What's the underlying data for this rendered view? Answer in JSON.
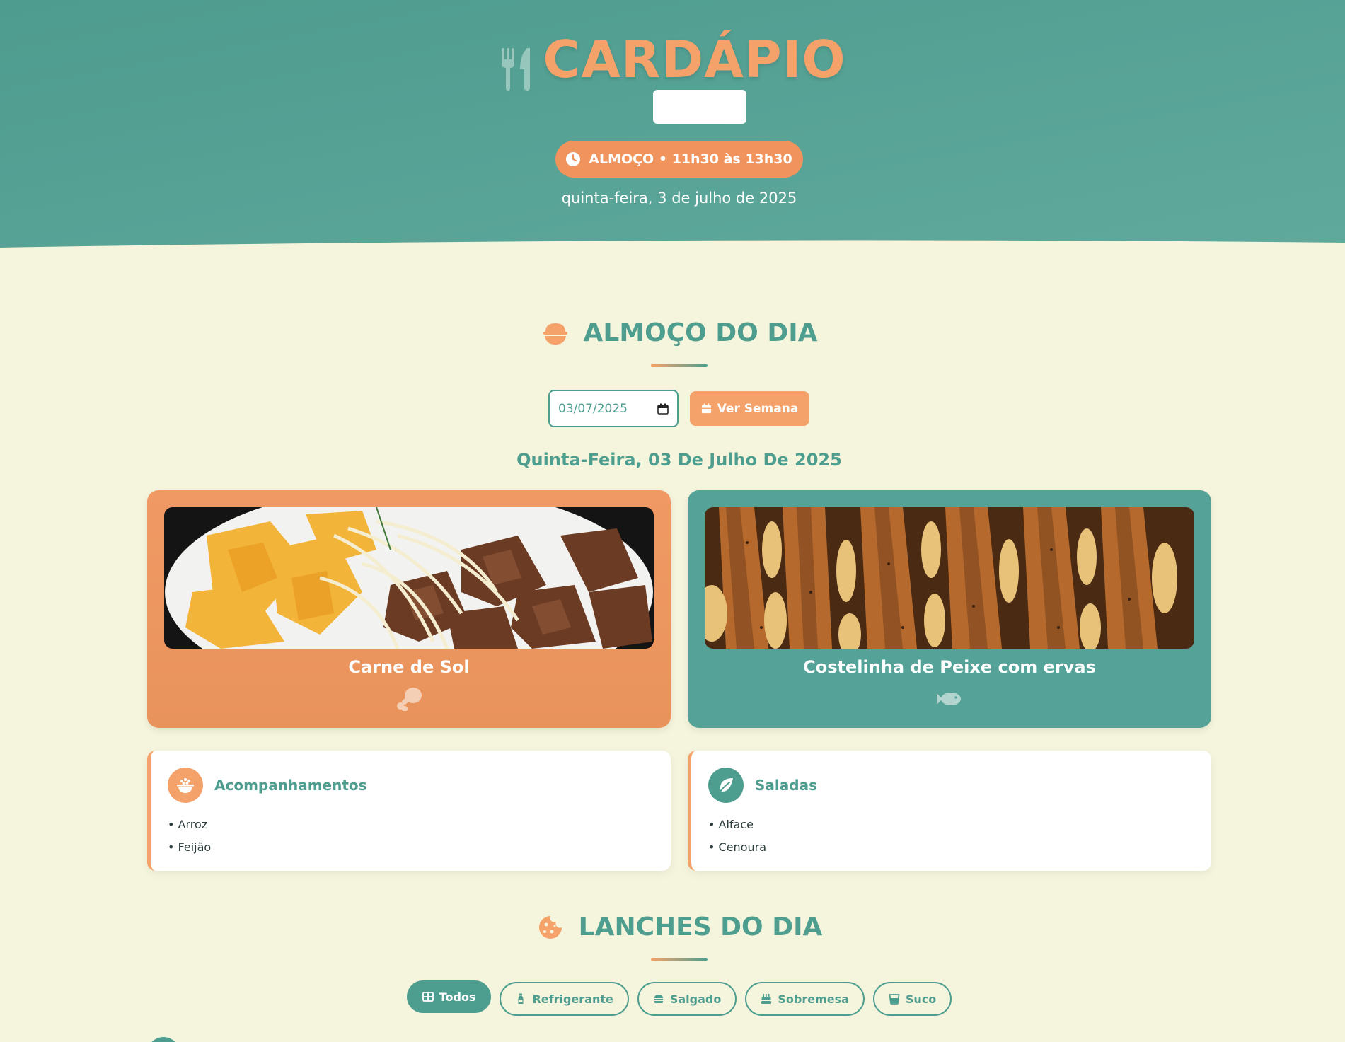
{
  "header": {
    "title": "CARDÁPIO",
    "meal_label": "ALMOÇO • 11h30 às 13h30",
    "date_long": "quinta-feira, 3 de julho de 2025",
    "icon": "utensils-icon"
  },
  "lunch": {
    "section_title": "ALMOÇO DO DIA",
    "section_icon": "bowl-icon",
    "date_value": "03/07/2025",
    "week_button": "Ver Semana",
    "day_label": "Quinta-Feira, 03 De Julho De 2025",
    "dishes": [
      {
        "name": "Carne de Sol",
        "type_icon": "drumstick-icon",
        "color": "#f09964"
      },
      {
        "name": "Costelinha de Peixe com ervas",
        "type_icon": "fish-icon",
        "color": "#55a398"
      }
    ],
    "sides": {
      "title": "Acompanhamentos",
      "items": [
        "Arroz",
        "Feijão"
      ]
    },
    "salads": {
      "title": "Saladas",
      "items": [
        "Alface",
        "Cenoura"
      ]
    }
  },
  "snacks": {
    "section_title": "LANCHES DO DIA",
    "section_icon": "cookie-icon",
    "filters": [
      {
        "label": "Todos",
        "icon": "grid-icon",
        "active": true
      },
      {
        "label": "Refrigerante",
        "icon": "bottle-icon",
        "active": false
      },
      {
        "label": "Salgado",
        "icon": "burger-icon",
        "active": false
      },
      {
        "label": "Sobremesa",
        "icon": "cake-icon",
        "active": false
      },
      {
        "label": "Suco",
        "icon": "glass-icon",
        "active": false
      }
    ]
  },
  "colors": {
    "teal": "#4e9e90",
    "orange": "#f4a26a",
    "background": "#f5f4dc"
  }
}
